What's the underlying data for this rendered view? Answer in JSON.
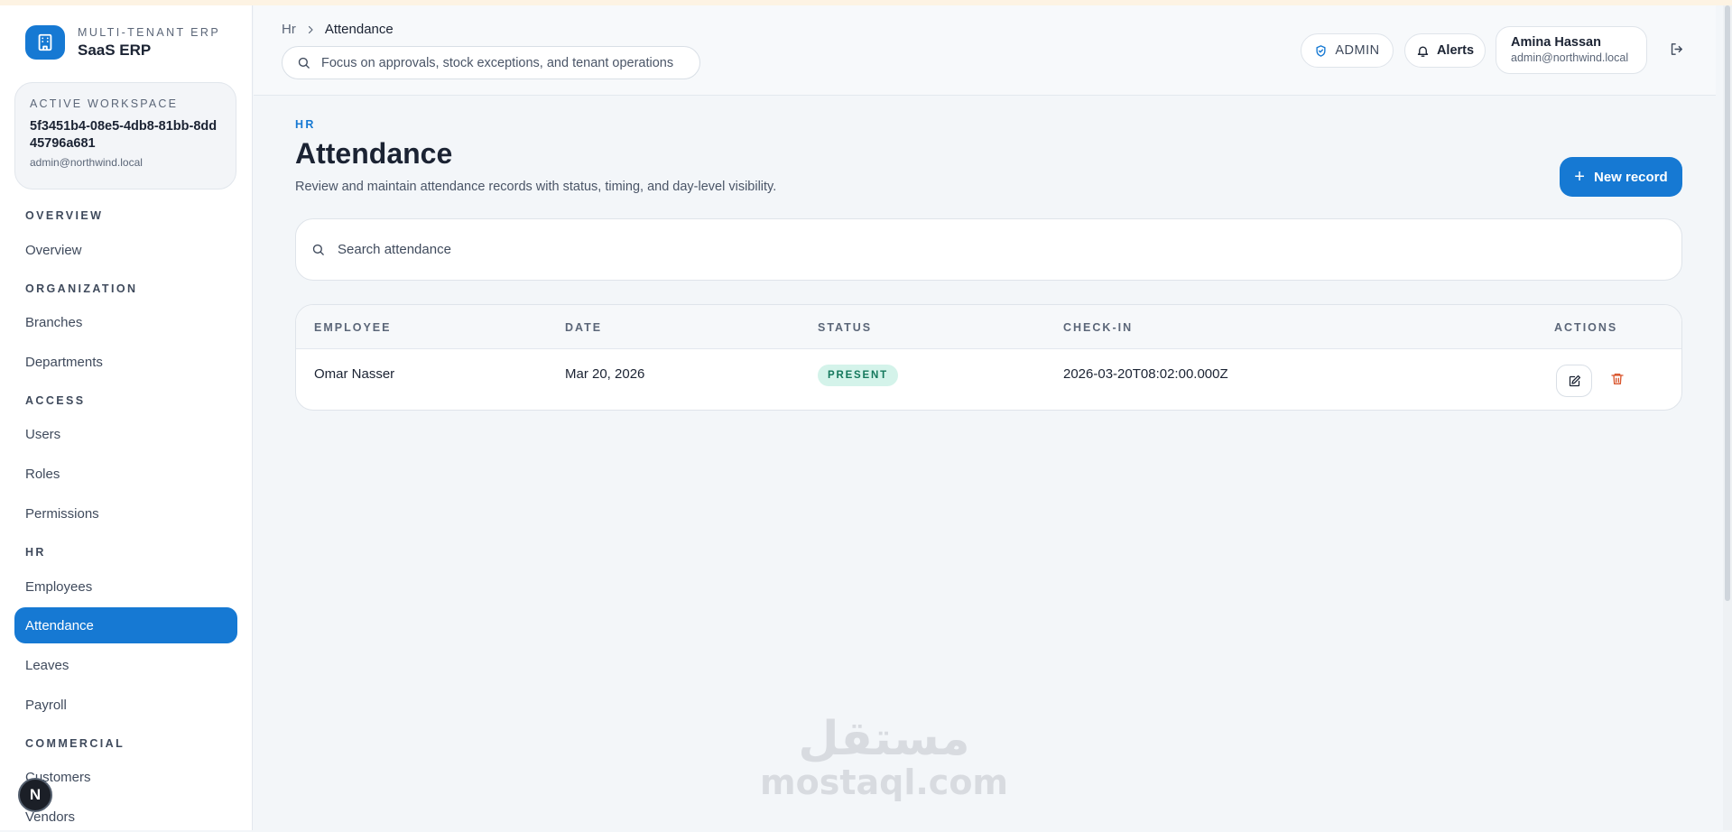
{
  "brand": {
    "eyebrow": "MULTI-TENANT ERP",
    "name": "SaaS ERP"
  },
  "workspace": {
    "label": "ACTIVE WORKSPACE",
    "id": "5f3451b4-08e5-4db8-81bb-8dd45796a681",
    "email": "admin@northwind.local"
  },
  "nav": {
    "sections": [
      "OVERVIEW",
      "ORGANIZATION",
      "ACCESS",
      "HR",
      "COMMERCIAL"
    ],
    "items": [
      "Overview",
      "Branches",
      "Departments",
      "Users",
      "Roles",
      "Permissions",
      "Employees",
      "Attendance",
      "Leaves",
      "Payroll",
      "Customers",
      "Vendors"
    ],
    "active": "Attendance"
  },
  "header": {
    "breadcrumb": {
      "root": "Hr",
      "current": "Attendance"
    },
    "search_placeholder": "Focus on approvals, stock exceptions, and tenant operations",
    "role_label": "ADMIN",
    "alerts_label": "Alerts",
    "user": {
      "name": "Amina Hassan",
      "email": "admin@northwind.local"
    }
  },
  "page": {
    "eyebrow": "HR",
    "title": "Attendance",
    "subtitle": "Review and maintain attendance records with status, timing, and day-level visibility.",
    "new_button": "New record",
    "search_placeholder": "Search attendance"
  },
  "table": {
    "columns": [
      "EMPLOYEE",
      "DATE",
      "STATUS",
      "CHECK-IN",
      "ACTIONS"
    ],
    "rows": [
      {
        "employee": "Omar Nasser",
        "date": "Mar 20, 2026",
        "status": "PRESENT",
        "check_in": "2026-03-20T08:02:00.000Z"
      }
    ]
  },
  "badge_letter": "N",
  "watermark": {
    "arabic": "مستقل",
    "latin": "mostaql.com"
  },
  "colors": {
    "accent": "#1679d3",
    "status_present_bg": "#d4f3ea",
    "status_present_text": "#14785c",
    "danger": "#d9542b"
  }
}
